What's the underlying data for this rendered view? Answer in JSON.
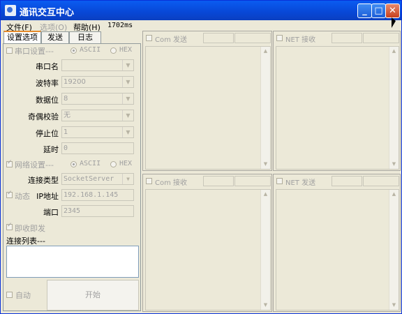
{
  "window": {
    "title": "通讯交互中心",
    "controls": {
      "minimize": "_",
      "maximize": "□",
      "close": "✕"
    },
    "title_color": "#0a5cf1"
  },
  "menubar": {
    "items": [
      "文件(F)",
      "选项(O)",
      "帮助(H)"
    ],
    "latency": "1702ms"
  },
  "tabs": [
    "设置选项",
    "发送",
    "日志"
  ],
  "serial": {
    "header": "串口设置---",
    "mode_ascii": "ASCII",
    "mode_hex": "HEX",
    "fields": [
      {
        "label": "串口名",
        "value": ""
      },
      {
        "label": "波特率",
        "value": "19200"
      },
      {
        "label": "数据位",
        "value": "8"
      },
      {
        "label": "奇偶校验",
        "value": "无"
      },
      {
        "label": "停止位",
        "value": "1"
      }
    ],
    "delay_label": "延时",
    "delay_value": "0"
  },
  "network": {
    "header": "网络设置---",
    "mode_ascii": "ASCII",
    "mode_hex": "HEX",
    "conn_type_label": "连接类型",
    "conn_type_value": "SocketServer",
    "dynamic_label": "动态",
    "ip_label": "IP地址",
    "ip_value": "192.168.1.145",
    "port_label": "端口",
    "port_value": "2345"
  },
  "instant_send_label": "即收即发",
  "connection_list_label": "连接列表---",
  "auto_label": "自动",
  "start_button": "开始",
  "panes": {
    "com_send": "Com 发送",
    "net_recv": "NET 接收",
    "com_recv": "Com 接收",
    "net_send": "NET 发送"
  },
  "icons": {
    "scroll_up": "▲",
    "scroll_down": "▼",
    "dropdown": "▼"
  }
}
